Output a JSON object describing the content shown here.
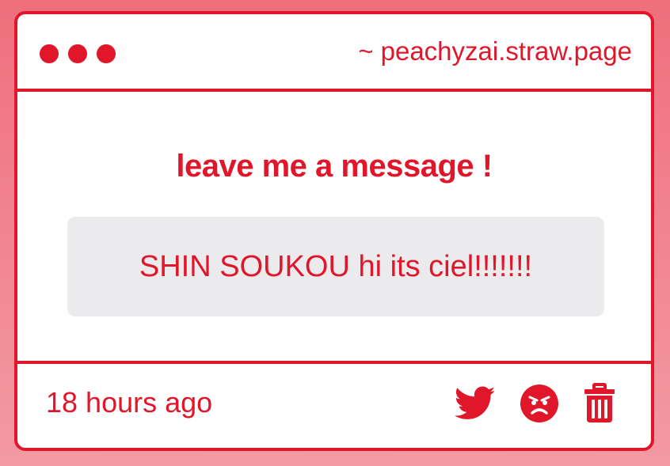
{
  "window": {
    "url": "~ peachyzai.straw.page",
    "window_controls": [
      "dot",
      "dot",
      "dot"
    ]
  },
  "main": {
    "heading": "leave me a message !",
    "message": "SHIN SOUKOU hi its ciel!!!!!!!"
  },
  "footer": {
    "timestamp": "18 hours ago",
    "actions": [
      {
        "icon": "twitter-bird-icon"
      },
      {
        "icon": "angry-face-icon"
      },
      {
        "icon": "trash-can-icon"
      }
    ]
  },
  "colors": {
    "accent": "#e0162b",
    "background_top": "#ef6f7c",
    "background_bottom": "#f39aa3",
    "message_box": "#ebeaec",
    "card": "#ffffff"
  }
}
